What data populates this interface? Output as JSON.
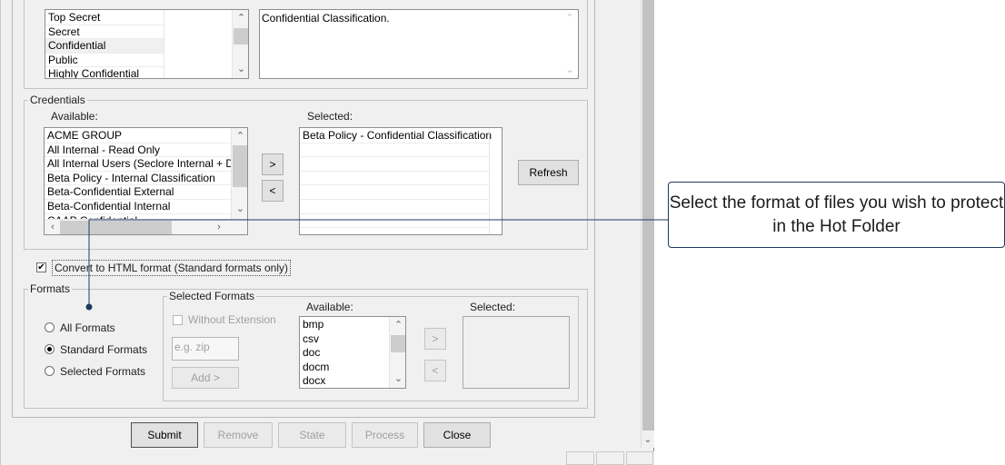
{
  "classification": {
    "items": [
      "Top Secret",
      "Secret",
      "Confidential",
      "Public",
      "Highly Confidential"
    ],
    "selected_index": 2,
    "description": "Confidential Classification."
  },
  "credentials": {
    "legend": "Credentials",
    "available_label": "Available:",
    "selected_label": "Selected:",
    "available_items": [
      "ACME GROUP",
      "All Internal - Read Only",
      "All Internal Users (Seclore Internal + D",
      "Beta Policy - Internal Classification",
      "Beta-Confidential External",
      "Beta-Confidential Internal",
      "CAAP Confidential"
    ],
    "selected_items": [
      "Beta Policy - Confidential Classification"
    ],
    "add_label": ">",
    "remove_label": "<",
    "refresh_label": "Refresh"
  },
  "convert_html": {
    "label": "Convert to HTML format (Standard formats only)",
    "checked": true
  },
  "formats": {
    "legend": "Formats",
    "options": [
      "All Formats",
      "Standard Formats",
      "Selected Formats"
    ],
    "selected_index": 1,
    "selected_formats": {
      "legend": "Selected Formats",
      "without_extension_label": "Without Extension",
      "extension_placeholder": "e.g. zip",
      "add_button_label": "Add >",
      "available_label": "Available:",
      "selected_label": "Selected:",
      "available_items": [
        "bmp",
        "csv",
        "doc",
        "docm",
        "docx"
      ],
      "move_right_label": ">",
      "move_left_label": "<"
    }
  },
  "footer": {
    "submit": "Submit",
    "remove": "Remove",
    "state": "State",
    "process": "Process",
    "close": "Close"
  },
  "callout": {
    "text": "Select the format of files you wish to protect in the Hot Folder"
  }
}
